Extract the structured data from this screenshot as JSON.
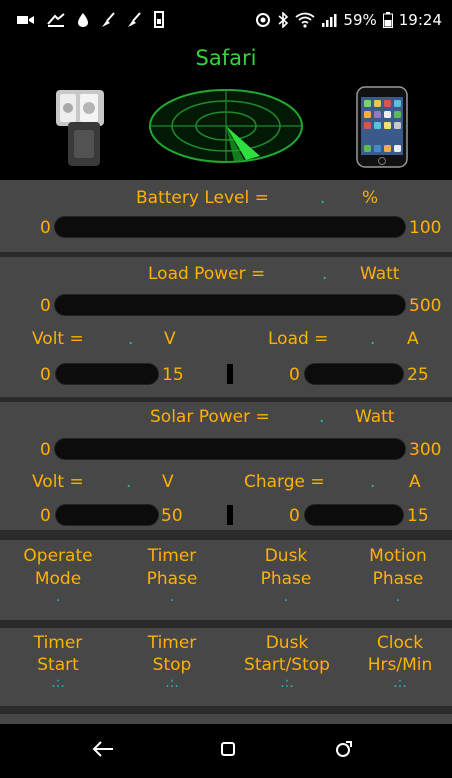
{
  "status_bar": {
    "battery_percent": "59%",
    "time": "19:24",
    "icons_left": [
      "video-icon",
      "app-notification-icon",
      "app-notification-icon",
      "broom-icon",
      "broom-icon",
      "storage-icon"
    ],
    "icons_right": [
      "location-icon",
      "bluetooth-icon",
      "wifi-icon",
      "signal-icon",
      "battery-icon"
    ]
  },
  "header": {
    "title": "Safari",
    "title_color": "#34d43c"
  },
  "battery": {
    "label": "Battery Level =",
    "value": ".",
    "unit": "%",
    "min": "0",
    "max": "100",
    "level": 0
  },
  "load": {
    "power_label": "Load Power =",
    "power_value": ".",
    "power_unit": "Watt",
    "power_min": "0",
    "power_max": "500",
    "volt_label": "Volt =",
    "volt_value": ".",
    "volt_unit": "V",
    "volt_min": "0",
    "volt_max": "15",
    "amp_label": "Load =",
    "amp_value": ".",
    "amp_unit": "A",
    "amp_min": "0",
    "amp_max": "25"
  },
  "solar": {
    "power_label": "Solar Power =",
    "power_value": ".",
    "power_unit": "Watt",
    "power_min": "0",
    "power_max": "300",
    "volt_label": "Volt =",
    "volt_value": ".",
    "volt_unit": "V",
    "volt_min": "0",
    "volt_max": "50",
    "amp_label": "Charge =",
    "amp_value": ".",
    "amp_unit": "A",
    "amp_min": "0",
    "amp_max": "15"
  },
  "modes": [
    {
      "line1": "Operate",
      "line2": "Mode",
      "value": "."
    },
    {
      "line1": "Timer",
      "line2": "Phase",
      "value": "."
    },
    {
      "line1": "Dusk",
      "line2": "Phase",
      "value": "."
    },
    {
      "line1": "Motion",
      "line2": "Phase",
      "value": "."
    }
  ],
  "timers": [
    {
      "line1": "Timer",
      "line2": "Start",
      "value": ".:."
    },
    {
      "line1": "Timer",
      "line2": "Stop",
      "value": ".:."
    },
    {
      "line1": "Dusk",
      "line2": "Start/Stop",
      "value": ".:."
    },
    {
      "line1": "Clock",
      "line2": "Hrs/Min",
      "value": ".:."
    }
  ],
  "colors": {
    "accent_orange": "#ffb000",
    "value_cyan": "#22b8c8",
    "panel_gray": "#474747"
  }
}
